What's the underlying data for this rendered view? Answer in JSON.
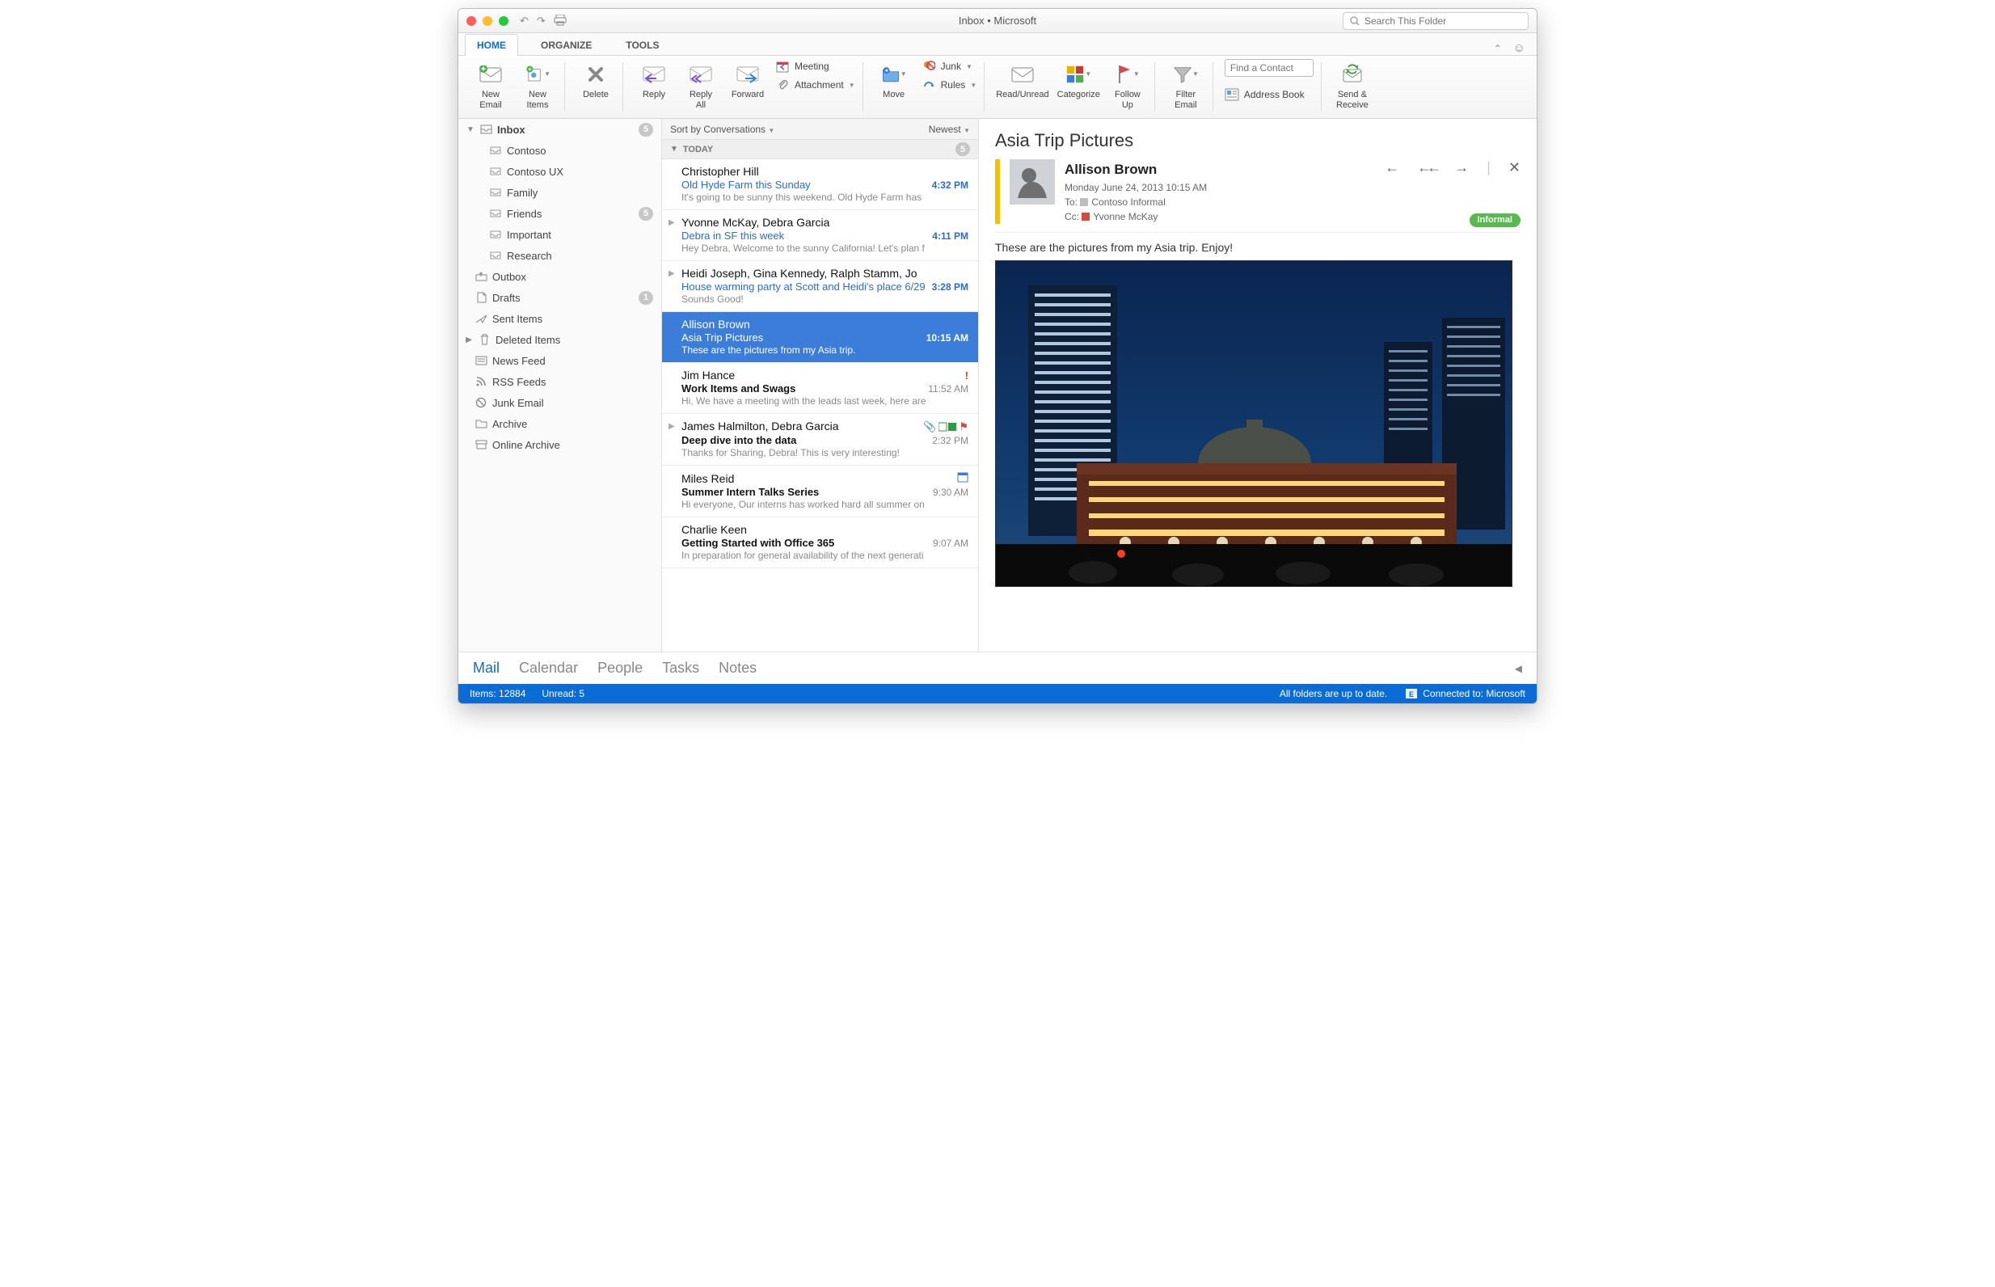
{
  "window": {
    "title": "Inbox • Microsoft"
  },
  "search": {
    "placeholder": "Search This Folder"
  },
  "tabs": {
    "home": "HOME",
    "organize": "ORGANIZE",
    "tools": "TOOLS"
  },
  "ribbon": {
    "newEmail": "New\nEmail",
    "newItems": "New\nItems",
    "delete": "Delete",
    "reply": "Reply",
    "replyAll": "Reply\nAll",
    "forward": "Forward",
    "meeting": "Meeting",
    "attachment": "Attachment",
    "move": "Move",
    "junk": "Junk",
    "rules": "Rules",
    "readUnread": "Read/Unread",
    "categorize": "Categorize",
    "followUp": "Follow\nUp",
    "filterEmail": "Filter\nEmail",
    "findContactPlaceholder": "Find a Contact",
    "addressBook": "Address Book",
    "sendReceive": "Send &\nReceive"
  },
  "sidebar": {
    "inbox": {
      "label": "Inbox",
      "count": "5",
      "children": [
        {
          "label": "Contoso"
        },
        {
          "label": "Contoso UX"
        },
        {
          "label": "Family"
        },
        {
          "label": "Friends",
          "count": "5"
        },
        {
          "label": "Important"
        },
        {
          "label": "Research"
        }
      ]
    },
    "outbox": "Outbox",
    "drafts": {
      "label": "Drafts",
      "count": "1"
    },
    "sent": "Sent Items",
    "deleted": "Deleted Items",
    "news": "News Feed",
    "rss": "RSS Feeds",
    "junk": "Junk Email",
    "archive": "Archive",
    "online": "Online Archive"
  },
  "msglist": {
    "sortBy": "Sort by Conversations",
    "newest": "Newest",
    "today": "TODAY",
    "todayCount": "5",
    "items": [
      {
        "from": "Christopher Hill",
        "subject": "Old Hyde Farm this Sunday",
        "preview": "It's going to be sunny this weekend. Old Hyde Farm has",
        "time": "4:32 PM",
        "unread": true
      },
      {
        "from": "Yvonne McKay, Debra Garcia",
        "subject": "Debra in SF this week",
        "preview": "Hey Debra, Welcome to the sunny California! Let's plan f",
        "time": "4:11 PM",
        "unread": true,
        "chev": true
      },
      {
        "from": "Heidi Joseph, Gina Kennedy, Ralph Stamm, Jo",
        "subject": "House warming party at Scott and Heidi's place 6/29",
        "preview": "Sounds Good!",
        "time": "3:28 PM",
        "unread": true,
        "chev": true
      },
      {
        "from": "Allison Brown",
        "subject": "Asia Trip Pictures",
        "preview": "These are the pictures from my Asia trip.",
        "time": "10:15 AM",
        "selected": true
      },
      {
        "from": "Jim Hance",
        "subject": "Work Items and Swags",
        "preview": "Hi, We have a meeting with the leads last week, here are",
        "time": "11:52 AM",
        "read": true,
        "priority": true
      },
      {
        "from": "James Halmilton, Debra Garcia",
        "subject": "Deep dive into the data",
        "preview": "Thanks for Sharing, Debra! This is very interesting!",
        "time": "2:32 PM",
        "read": true,
        "chev": true,
        "attach": true,
        "cat": true,
        "flag": true
      },
      {
        "from": "Miles Reid",
        "subject": "Summer Intern Talks Series",
        "preview": "Hi everyone, Our interns has worked hard all summer on",
        "time": "9:30 AM",
        "read": true,
        "cal": true
      },
      {
        "from": "Charlie Keen",
        "subject": "Getting Started with Office 365",
        "preview": "In preparation for general availability of the next generati",
        "time": "9:07 AM",
        "read": true
      }
    ]
  },
  "reading": {
    "subject": "Asia Trip Pictures",
    "from": "Allison Brown",
    "date": "Monday June 24, 2013 10:15 AM",
    "toLabel": "To:",
    "to": "Contoso Informal",
    "ccLabel": "Cc:",
    "cc": "Yvonne McKay",
    "badge": "Informal",
    "body": "These are the pictures from my Asia trip.   Enjoy!"
  },
  "bottomnav": {
    "mail": "Mail",
    "calendar": "Calendar",
    "people": "People",
    "tasks": "Tasks",
    "notes": "Notes"
  },
  "status": {
    "items": "Items: 12884",
    "unread": "Unread: 5",
    "syncMsg": "All folders are up to date.",
    "connected": "Connected to: Microsoft"
  }
}
